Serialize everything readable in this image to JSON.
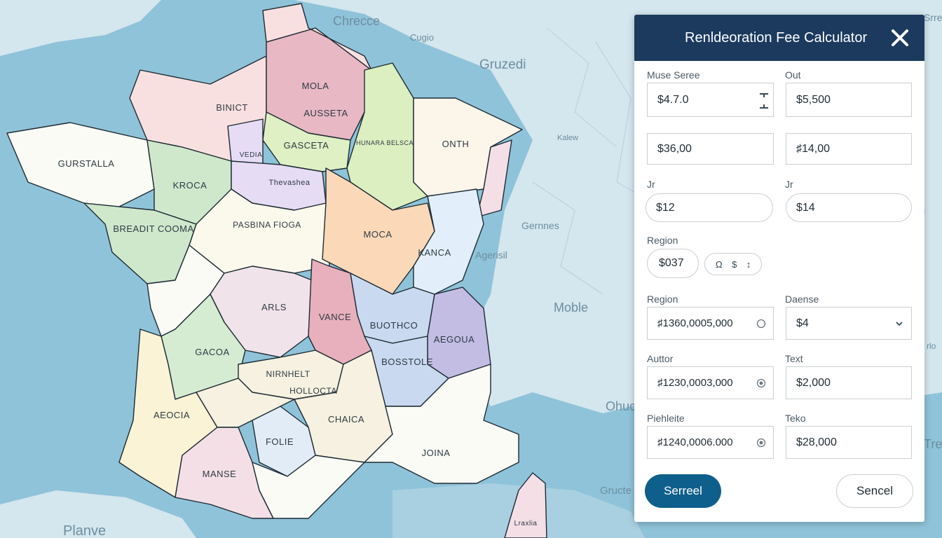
{
  "map": {
    "place_labels": [
      {
        "id": "chrecce",
        "text": "Chrecce"
      },
      {
        "id": "cugio",
        "text": "Cugio"
      },
      {
        "id": "gruzedi",
        "text": "Gruzedi"
      },
      {
        "id": "kalew",
        "text": "Kalew"
      },
      {
        "id": "gernnes",
        "text": "Gernnes"
      },
      {
        "id": "agerisil",
        "text": "Agerisil"
      },
      {
        "id": "moble",
        "text": "Moble"
      },
      {
        "id": "ohuc",
        "text": "Ohuc"
      },
      {
        "id": "gructe",
        "text": "Gructe"
      },
      {
        "id": "planve",
        "text": "Planve"
      },
      {
        "id": "srre",
        "text": "Srre"
      },
      {
        "id": "tre",
        "text": "Tre"
      },
      {
        "id": "rlo",
        "text": "rlo"
      }
    ],
    "regions": [
      {
        "id": "mola",
        "label": "MOLA",
        "color": "#e8b8c4"
      },
      {
        "id": "ausseta",
        "label": "AUSSETA",
        "color": "#e8b8c4"
      },
      {
        "id": "binict",
        "label": "BINICT",
        "color": "#f9e0e0"
      },
      {
        "id": "gurstalla",
        "label": "GURSTALLA",
        "color": "#fbfbf5"
      },
      {
        "id": "gasceta",
        "label": "GASCETA",
        "color": "#dff0c4"
      },
      {
        "id": "vedia",
        "label": "VEDIA",
        "color": "#e6dcf4"
      },
      {
        "id": "hunara",
        "label": "HUNARA BELSCA",
        "color": "#dcefc0"
      },
      {
        "id": "onth",
        "label": "ONTH",
        "color": "#fbf5ea"
      },
      {
        "id": "kroca",
        "label": "KROCA",
        "color": "#cfe8cc"
      },
      {
        "id": "breadit",
        "label": "BREADIT COOMA",
        "color": "#cfe8cc"
      },
      {
        "id": "thevashea",
        "label": "Thevashea",
        "color": "#e6dcf4"
      },
      {
        "id": "pasbina",
        "label": "PASBINA FIOGA",
        "color": "#fbf8ec"
      },
      {
        "id": "moca",
        "label": "MOCA",
        "color": "#fbd9b8"
      },
      {
        "id": "kanca",
        "label": "KANCA",
        "color": "#e2effa"
      },
      {
        "id": "arls",
        "label": "ARLS",
        "color": "#f1e3ea"
      },
      {
        "id": "vance",
        "label": "VANCE",
        "color": "#e8b0bc"
      },
      {
        "id": "buotho",
        "label": "BUOTHCO",
        "color": "#c9d9f0"
      },
      {
        "id": "aegoua",
        "label": "AEGOUA",
        "color": "#c3bde4"
      },
      {
        "id": "bosstole",
        "label": "BOSSTOLE",
        "color": "#c9d9f0"
      },
      {
        "id": "gacoa",
        "label": "GACOA",
        "color": "#d6ecd2"
      },
      {
        "id": "nirnhelt",
        "label": "NIRNHELT",
        "color": "#f6f1e0"
      },
      {
        "id": "hollocta",
        "label": "HOLLOCTA",
        "color": "#f6f1e0"
      },
      {
        "id": "aeocia",
        "label": "AEOCIA",
        "color": "#fbf3d6"
      },
      {
        "id": "chaica",
        "label": "CHAICA",
        "color": "#f6f1e0"
      },
      {
        "id": "folie",
        "label": "FOLIE",
        "color": "#e2ecf6"
      },
      {
        "id": "joina",
        "label": "JOINA",
        "color": "#fbfbf5"
      },
      {
        "id": "manse",
        "label": "MANSE",
        "color": "#f5dfe6"
      },
      {
        "id": "corsica",
        "label": "Lraxlia",
        "color": "#f5dfe6"
      }
    ]
  },
  "calculator": {
    "title": "Renldeoration Fee Calculator",
    "close_icon": "close-icon",
    "labels": {
      "muse_seree": "Muse Seree",
      "out": "Out",
      "jr_left": "Jr",
      "jr_right": "Jr",
      "region_1": "Region",
      "region_2": "Region",
      "daense": "Daense",
      "auttor": "Auttor",
      "text_1": "Text",
      "piehleite": "Piehleite",
      "teko": "Teko"
    },
    "fields": {
      "muse_seree": "$4.7.0",
      "out": "$5,500",
      "row2_left": "$36,00",
      "row2_right": "♯14,00",
      "jr_left": "$12",
      "jr_right": "$14",
      "region_value": "$037",
      "mini_controls": [
        "Ω",
        "$",
        "↕"
      ],
      "region_large": "♯1360,0005,000",
      "daense": "$4",
      "auttor": "♯1230,0003,000",
      "text_1": "$2,000",
      "piehleite": "♯1240,0006.000",
      "teko": "$28,000"
    },
    "buttons": {
      "primary": "Serreel",
      "secondary": "Sencel"
    },
    "colors": {
      "header": "#1b3a5e",
      "primary_button": "#0f5f8c"
    }
  }
}
